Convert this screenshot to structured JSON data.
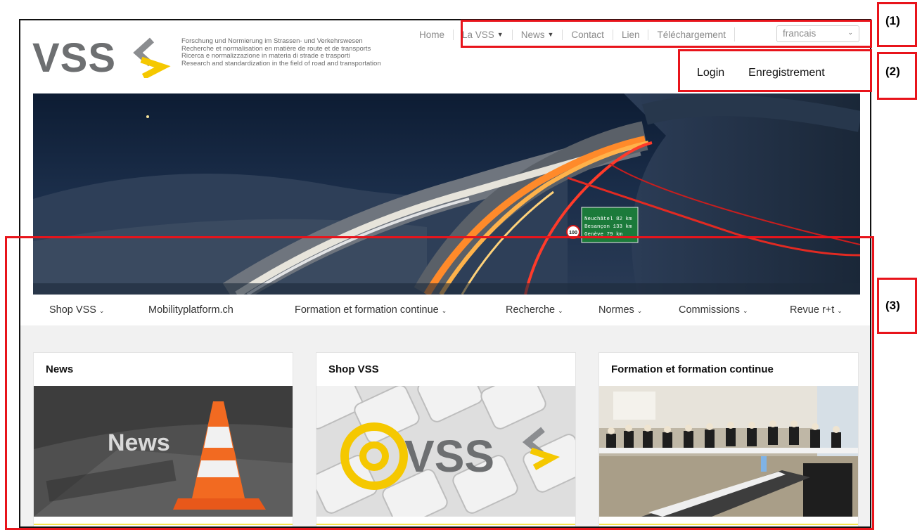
{
  "brand": {
    "logo_text": "VSS",
    "tagline": [
      "Forschung und Normierung im Strassen- und Verkehrswesen",
      "Recherche et normalisation en matière de route et de transports",
      "Ricerca e normalizzazione in materia di strade e trasporti",
      "Research and standardization in the field of road and transportation"
    ]
  },
  "topnav": {
    "home": "Home",
    "la_vss": "La VSS",
    "news": "News",
    "contact": "Contact",
    "lien": "Lien",
    "telechargement": "Téléchargement",
    "language": "francais"
  },
  "account": {
    "login": "Login",
    "register": "Enregistrement"
  },
  "hero": {
    "sign_lines": [
      "Neuchâtel  82 km",
      "Besançon  133 km",
      "Genève     79 km"
    ],
    "speed_limit": "100"
  },
  "mainnav": {
    "shop": "Shop VSS",
    "mobility": "Mobilityplatform.ch",
    "formation": "Formation et formation continue",
    "recherche": "Recherche",
    "normes": "Normes",
    "commissions": "Commissions",
    "revue": "Revue r+t"
  },
  "cards": {
    "news": {
      "title": "News",
      "image_text": "News"
    },
    "shop": {
      "title": "Shop VSS",
      "image_text": "VSS"
    },
    "formation": {
      "title": "Formation et formation continue"
    }
  },
  "annotations": {
    "label_1": "(1)",
    "label_2": "(2)",
    "label_3": "(3)"
  },
  "colors": {
    "brand_gray": "#6d6f71",
    "brand_yellow": "#f5c800",
    "annotation_red": "#e8141b"
  }
}
